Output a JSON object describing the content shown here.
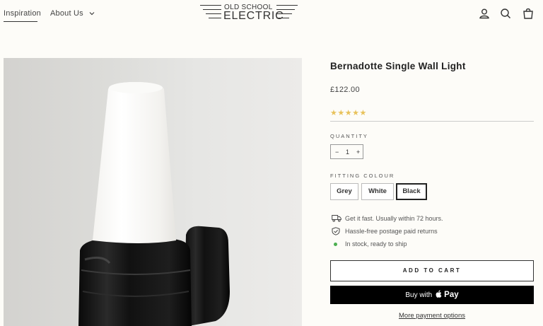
{
  "header": {
    "nav": [
      {
        "label": "Inspiration"
      },
      {
        "label": "About Us"
      }
    ],
    "logo": {
      "line1": "OLD SCHOOL",
      "line2": "ELECTRIC"
    },
    "icons": [
      "account-icon",
      "search-icon",
      "cart-icon"
    ]
  },
  "product": {
    "title": "Bernadotte Single Wall Light",
    "price": "£122.00",
    "rating": {
      "stars": "★★★★★",
      "value": 5,
      "max": 5,
      "color": "#e8c25b"
    },
    "quantity_label": "QUANTITY",
    "quantity": {
      "minus": "−",
      "value": "1",
      "plus": "+"
    },
    "colour_label": "FITTING COLOUR",
    "colours": [
      {
        "label": "Grey",
        "selected": false
      },
      {
        "label": "White",
        "selected": false
      },
      {
        "label": "Black",
        "selected": true
      }
    ],
    "features": [
      {
        "icon": "delivery-truck-icon",
        "text": "Get it fast. Usually within 72 hours."
      },
      {
        "icon": "shield-check-icon",
        "text": "Hassle-free postage paid returns"
      },
      {
        "icon": "in-stock-dot-icon",
        "text": "In stock, ready to ship",
        "color": "#4caf50"
      }
    ],
    "add_to_cart": "ADD TO CART",
    "buy_with": "Buy with",
    "pay_brand": "Pay",
    "more_payment": "More payment options"
  },
  "colors": {
    "background": "#fdfcf8",
    "text": "#222222",
    "buy_button": "#000000"
  }
}
